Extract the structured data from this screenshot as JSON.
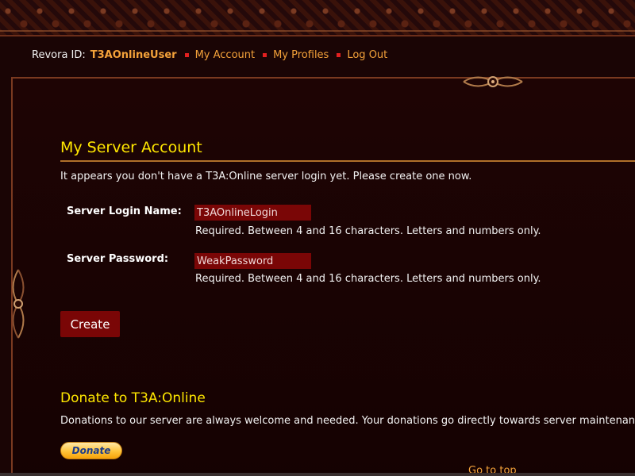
{
  "nav": {
    "revora_label": "Revora ID:",
    "username": "T3AOnlineUser",
    "links": [
      "My Account",
      "My Profiles",
      "Log Out"
    ]
  },
  "account": {
    "title": "My Server Account",
    "intro": "It appears you don't have a T3A:Online server login yet. Please create one now.",
    "login_label": "Server Login Name:",
    "login_value": "T3AOnlineLogin",
    "login_help": "Required. Between 4 and 16 characters. Letters and numbers only.",
    "password_label": "Server Password:",
    "password_value": "WeakPassword",
    "password_help": "Required. Between 4 and 16 characters. Letters and numbers only.",
    "create_label": "Create"
  },
  "donate": {
    "title": "Donate to T3A:Online",
    "text": "Donations to our server are always welcome and needed. Your donations go directly towards server maintenance",
    "button_label": "Donate"
  },
  "footer": {
    "go_to_top": "Go to top"
  },
  "colors": {
    "accent": "#f4a23a",
    "title": "#ffe700",
    "field_bg": "#7a0606",
    "background": "#1a0505"
  }
}
